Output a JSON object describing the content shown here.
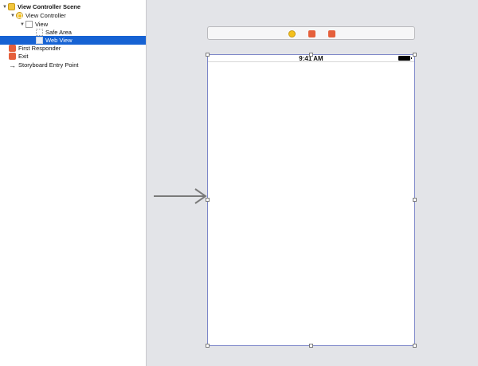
{
  "outline": {
    "items": [
      {
        "label": "View Controller Scene",
        "icon": "scene-icon"
      },
      {
        "label": "View Controller",
        "icon": "view-controller-icon"
      },
      {
        "label": "View",
        "icon": "view-icon"
      },
      {
        "label": "Safe Area",
        "icon": "safe-area-icon"
      },
      {
        "label": "Web View",
        "icon": "web-view-icon"
      },
      {
        "label": "First Responder",
        "icon": "first-responder-icon"
      },
      {
        "label": "Exit",
        "icon": "exit-icon"
      },
      {
        "label": "Storyboard Entry Point",
        "icon": "arrow-right-icon"
      }
    ],
    "selected": "Web View"
  },
  "device": {
    "status_time": "9:41 AM"
  },
  "colors": {
    "selection": "#1662d3",
    "canvas_bg": "#e3e4e8",
    "view_controller": "#f4c01c",
    "responder": "#e55f3b",
    "device_border": "#7c86c8"
  }
}
